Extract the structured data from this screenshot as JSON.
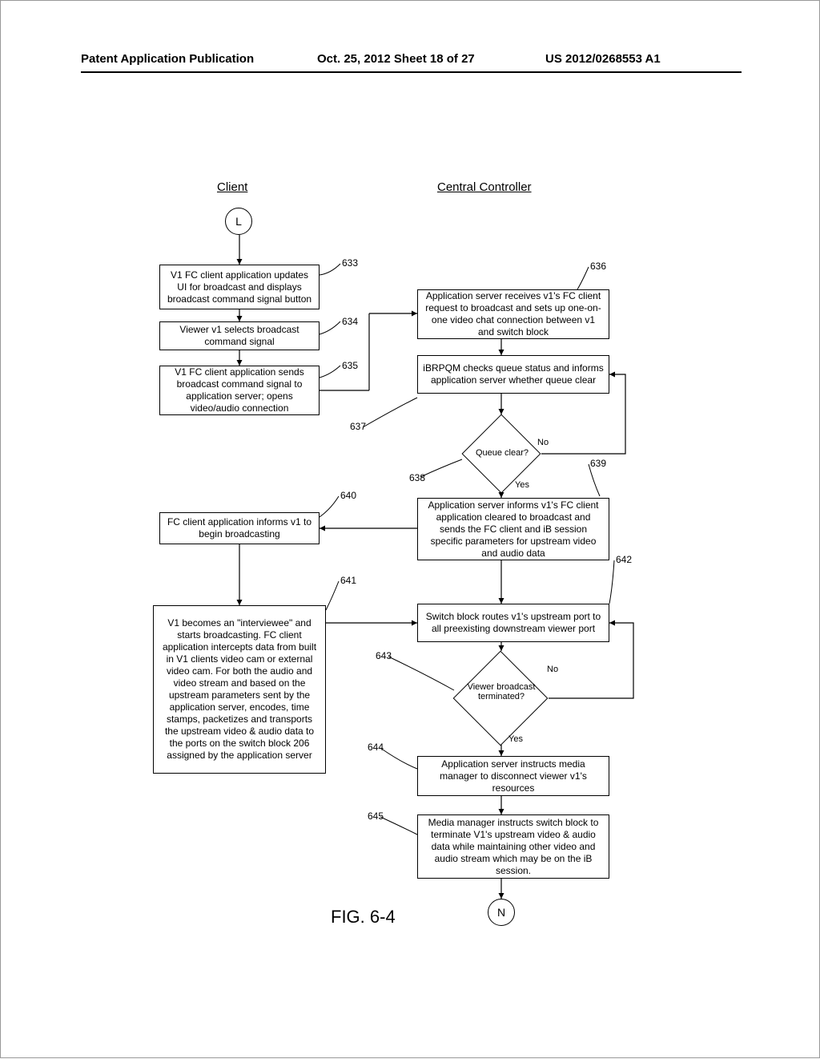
{
  "header": {
    "left": "Patent Application Publication",
    "mid": "Oct. 25, 2012  Sheet 18 of 27",
    "right": "US 2012/0268553 A1"
  },
  "columns": {
    "client": "Client",
    "controller": "Central Controller"
  },
  "connectors": {
    "L": "L",
    "N": "N"
  },
  "figure": "FIG. 6-4",
  "refs": {
    "r633": "633",
    "r634": "634",
    "r635": "635",
    "r636": "636",
    "r637": "637",
    "r638": "638",
    "r639": "639",
    "r640": "640",
    "r641": "641",
    "r642": "642",
    "r643": "643",
    "r644": "644",
    "r645": "645"
  },
  "boxes": {
    "b633": "V1 FC client application updates UI for broadcast  and displays broadcast command signal button",
    "b634": "Viewer v1 selects broadcast command signal",
    "b635": "V1 FC client application sends broadcast command signal to application server; opens video/audio connection",
    "b636": "Application server receives v1's FC client request to broadcast and sets up one-on-one video chat connection between v1 and switch block",
    "b637": "iBRPQM checks queue status and informs application server whether queue clear",
    "b639": "Application server informs v1's FC client application cleared to broadcast and sends the FC client and iB session specific parameters for upstream video and audio data",
    "b640": "FC client application informs v1 to begin broadcasting",
    "b641": "V1 becomes an \"interviewee\" and starts broadcasting.  FC client application intercepts data from built in V1 clients video cam or external video cam.  For both the audio and video stream and based on the upstream parameters sent by the application  server, encodes, time stamps, packetizes and transports the upstream video & audio data to the ports on the switch block 206 assigned by the application server",
    "b642": "Switch block routes v1's  upstream port to all preexisting downstream viewer port",
    "b644": "Application server instructs media manager to disconnect viewer v1's resources",
    "b645": "Media manager instructs switch block to terminate V1's upstream video & audio data while maintaining other video and audio stream which may be on the iB session."
  },
  "diamonds": {
    "d638": "Queue clear?",
    "d643": "Viewer broadcast terminated?"
  },
  "edgelabels": {
    "yes1": "Yes",
    "no1": "No",
    "yes2": "Yes",
    "no2": "No"
  }
}
